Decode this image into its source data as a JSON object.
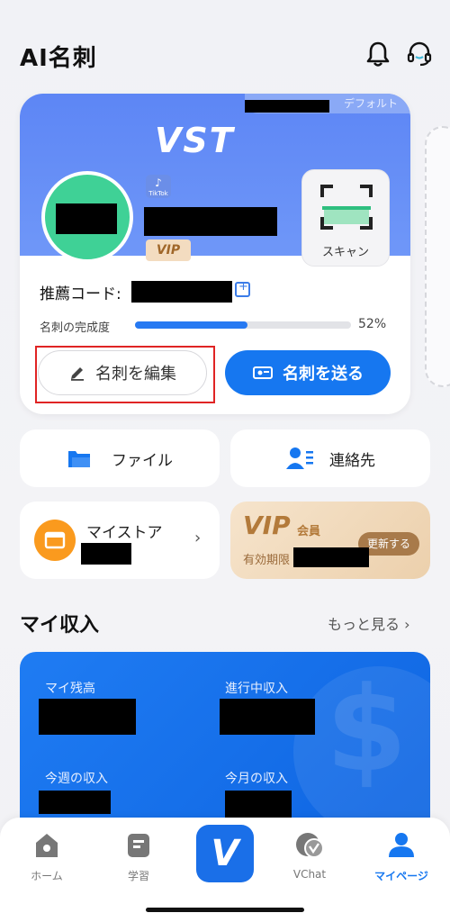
{
  "header": {
    "title": "AI名刺",
    "icons": [
      "bell-icon",
      "headset-icon"
    ]
  },
  "card": {
    "default_tag": "デフォルト",
    "logo": "VST",
    "tiktok_label": "TikTok",
    "vip_label": "VIP",
    "scan_label": "スキャン",
    "referral_label": "推薦コード:",
    "completion_label": "名刺の完成度",
    "completion_percent_text": "52%",
    "completion_value": 0.52,
    "edit_button": "名刺を編集",
    "send_button": "名刺を送る",
    "accent_color": "#1677f0"
  },
  "tiles": {
    "file": "ファイル",
    "contacts": "連絡先",
    "my_store": "マイストア",
    "vip_title": "VIP",
    "vip_member": "会員",
    "vip_expire": "有効期限",
    "renew": "更新する"
  },
  "income": {
    "title": "マイ収入",
    "more": "もっと見る",
    "balance": "マイ残高",
    "in_progress": "進行中収入",
    "this_week": "今週の収入",
    "this_month": "今月の収入"
  },
  "nav": {
    "home": "ホーム",
    "learn": "学習",
    "center": "V",
    "vchat": "VChat",
    "mypage": "マイページ",
    "active_color": "#1677f0"
  }
}
